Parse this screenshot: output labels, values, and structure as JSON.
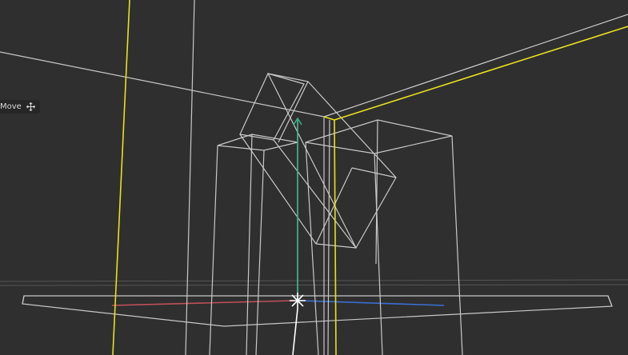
{
  "viewport": {
    "tool": {
      "label": "Move",
      "icon": "move-icon"
    }
  },
  "colors": {
    "background": "#2f2f2f",
    "wireframe": "#c8c8c8",
    "selection": "#e8e020",
    "axis_x": "#c0505a",
    "axis_y": "#3fae86",
    "axis_z": "#3a6fd0"
  }
}
